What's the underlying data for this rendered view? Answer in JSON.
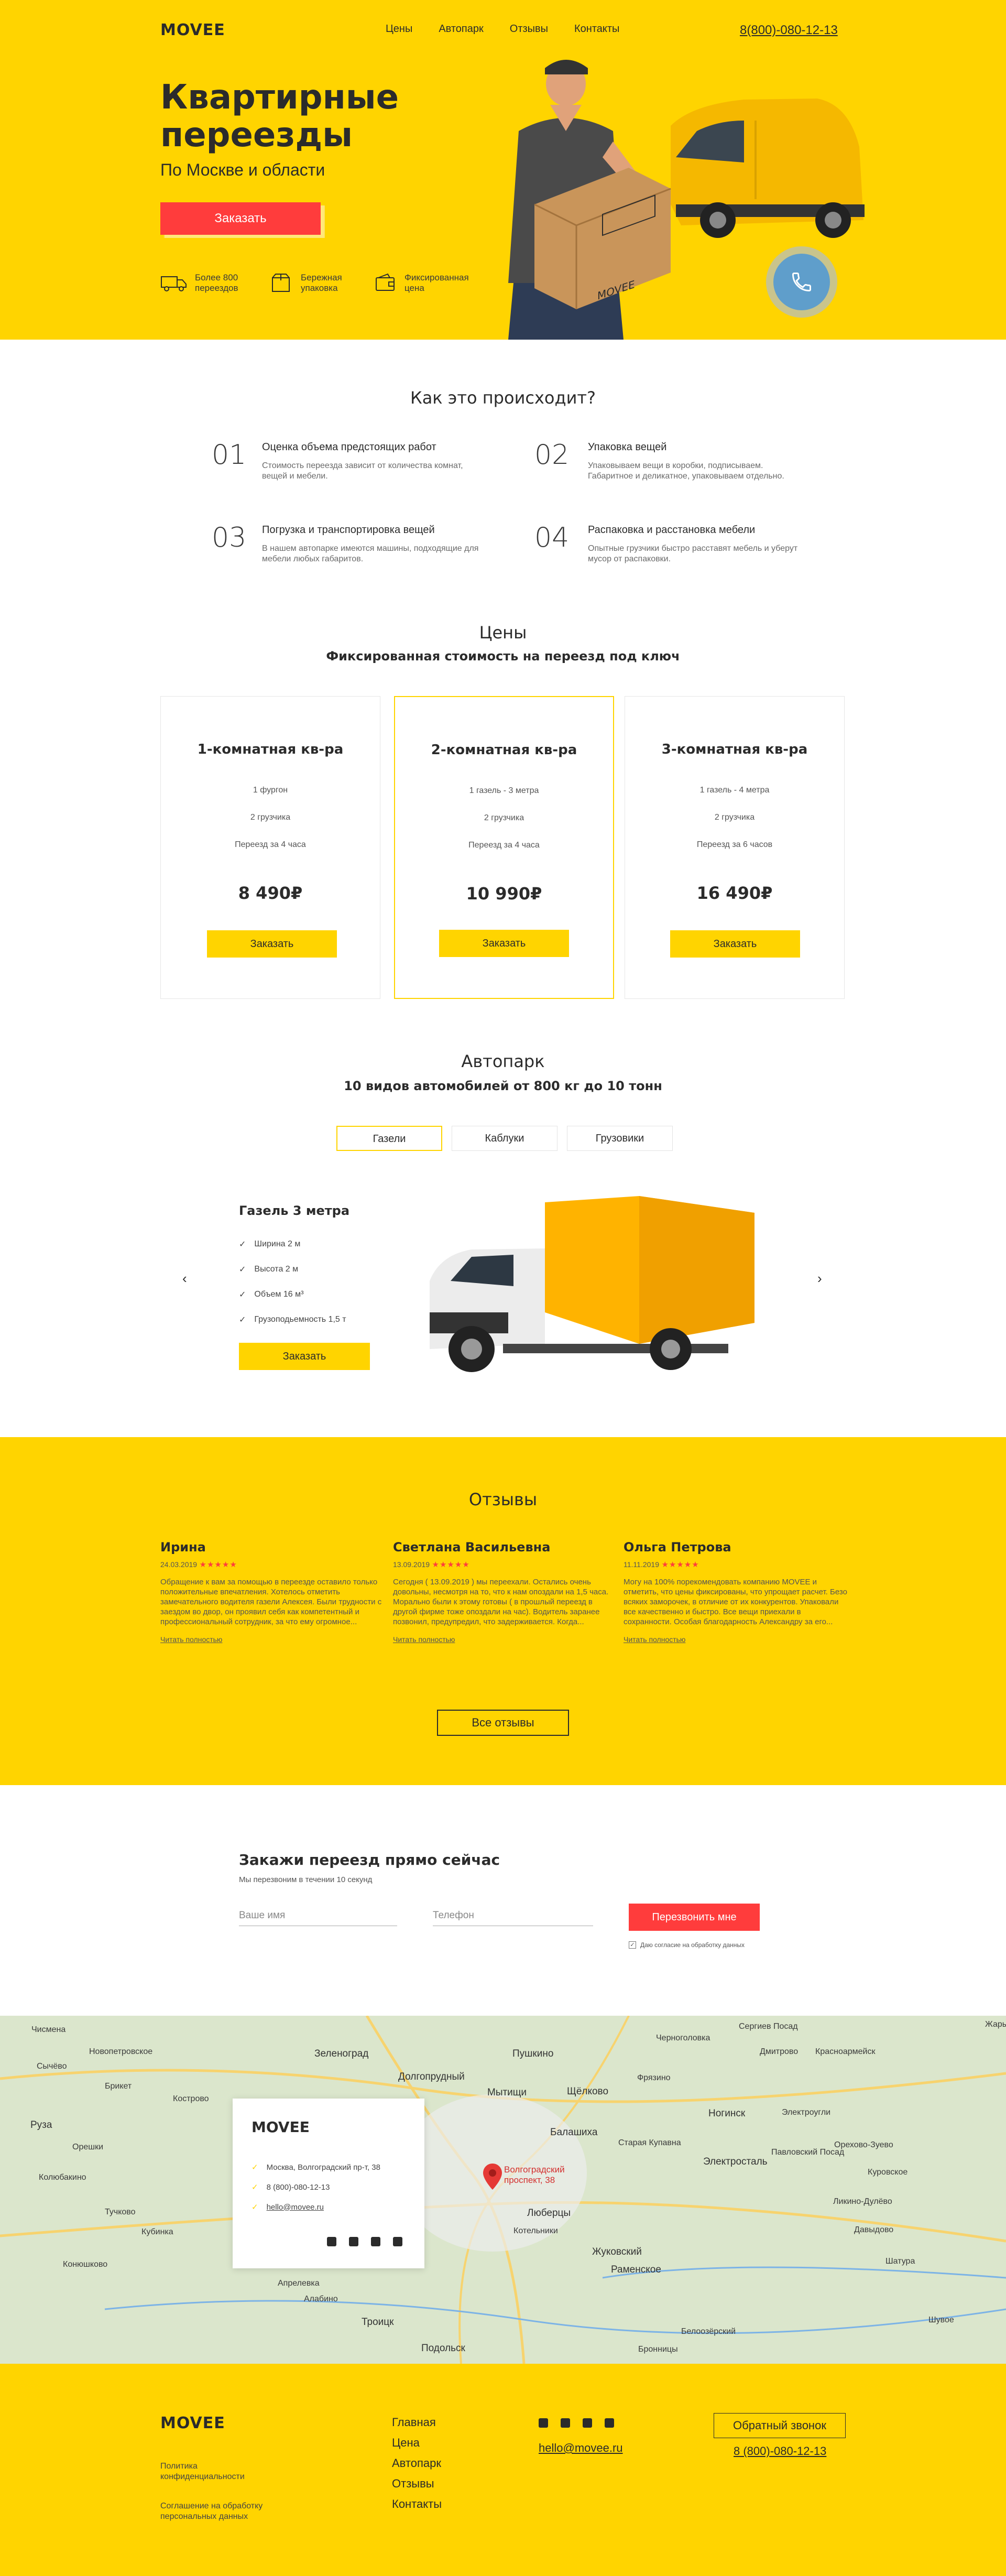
{
  "brand": {
    "logo": "MOVEE",
    "accent": "#ffd400",
    "cta": "#ff3c3c"
  },
  "header": {
    "nav": [
      "Цены",
      "Автопарк",
      "Отзывы",
      "Контакты"
    ],
    "phone": "8(800)-080-12-13"
  },
  "hero": {
    "title": "Квартирные переезды",
    "subtitle": "По Москве и области",
    "cta": "Заказать",
    "box_label": "MOVEE",
    "features": [
      {
        "icon": "truck-icon",
        "text": "Более 800 переездов"
      },
      {
        "icon": "box-icon",
        "text": "Бережная упаковка"
      },
      {
        "icon": "wallet-icon",
        "text": "Фиксированная цена"
      }
    ]
  },
  "how": {
    "title": "Как это происходит?",
    "steps": [
      {
        "num": "01",
        "title": "Оценка объема предстоящих работ",
        "text": "Стоимость переезда зависит от количества комнат, вещей и мебели."
      },
      {
        "num": "02",
        "title": "Упаковка вещей",
        "text": "Упаковываем вещи в коробки, подписываем. Габаритное и деликатное, упаковываем отдельно."
      },
      {
        "num": "03",
        "title": "Погрузка и транспортировка вещей",
        "text": "В нашем автопарке имеются машины, подходящие для мебели любых габаритов."
      },
      {
        "num": "04",
        "title": "Распаковка и расстановка мебели",
        "text": "Опытные грузчики быстро расставят мебель и уберут мусор от распаковки."
      }
    ]
  },
  "prices": {
    "title": "Цены",
    "subtitle": "Фиксированная стоимость на переезд под ключ",
    "cards": [
      {
        "title": "1-комнатная кв-ра",
        "lines": [
          "1 фургон",
          "2 грузчика",
          "Переезд за 4 часа"
        ],
        "price": "8 490₽",
        "button": "Заказать"
      },
      {
        "title": "2-комнатная кв-ра",
        "lines": [
          "1 газель - 3 метра",
          "2 грузчика",
          "Переезд за 4 часа"
        ],
        "price": "10 990₽",
        "button": "Заказать"
      },
      {
        "title": "3-комнатная кв-ра",
        "lines": [
          "1 газель - 4 метра",
          "2 грузчика",
          "Переезд за 6 часов"
        ],
        "price": "16 490₽",
        "button": "Заказать"
      }
    ]
  },
  "fleet": {
    "title": "Автопарк",
    "subtitle": "10 видов автомобилей от 800 кг до 10 тонн",
    "tabs": [
      "Газели",
      "Каблуки",
      "Грузовики"
    ],
    "active_tab": "Газели",
    "vehicle": {
      "name": "Газель 3 метра",
      "specs": [
        "Ширина 2 м",
        "Высота 2 м",
        "Объем 16 м³",
        "Грузоподьемность 1,5 т"
      ],
      "button": "Заказать"
    }
  },
  "reviews": {
    "title": "Отзывы",
    "items": [
      {
        "name": "Ирина",
        "date": "24.03.2019",
        "stars": "★★★★★",
        "text": "Обращение к вам за помощью в переезде оставило только положительные впечатления. Хотелось отметить замечательного водителя газели Алексея. Были трудности с заездом во двор, он проявил себя как компетентный и профессиональный сотрудник, за что ему огромное...",
        "link": "Читать полностью"
      },
      {
        "name": "Светлана Васильевна",
        "date": "13.09.2019",
        "stars": "★★★★★",
        "text": "Сегодня ( 13.09.2019 ) мы переехали. Остались очень довольны, несмотря на то, что к нам опоздали на 1,5 часа. Морально были к этому готовы ( в прошлый переезд в другой фирме тоже опоздали на час). Водитель заранее позвонил, предупредил, что задерживается. Когда...",
        "link": "Читать полностью"
      },
      {
        "name": "Ольга Петрова",
        "date": "11.11.2019",
        "stars": "★★★★★",
        "text": "Могу на 100% порекомендовать компанию MOVEE и отметить, что цены фиксированы, что упрощает расчет. Безо всяких заморочек, в отличие от их конкурентов. Упаковали все качественно и быстро. Все вещи приехали в сохранности. Особая благодарность Александру за его...",
        "link": "Читать полностью"
      }
    ],
    "all_button": "Все отзывы"
  },
  "order": {
    "title": "Закажи  переезд прямо сейчас",
    "subtitle": "Мы перезвоним в течении 10 секунд",
    "name_placeholder": "Ваше имя",
    "phone_placeholder": "Телефон",
    "button": "Перезвонить мне",
    "consent": "Даю согласие на обработку данных"
  },
  "map": {
    "card_logo": "MOVEE",
    "address": "Москва, Волгоградский пр-т, 38",
    "phone": "8 (800)-080-12-13",
    "email": "hello@movee.ru",
    "pin_label": "Волгоградский проспект, 38",
    "places": [
      "Чисмена",
      "Сычёво",
      "Новопетровское",
      "Брикет",
      "Кострово",
      "Руза",
      "Орешки",
      "Колюбакино",
      "Тучково",
      "Кубинка",
      "Конюшково",
      "Зеленоград",
      "Долгопрудный",
      "Мытищи",
      "Пушкино",
      "Щёлково",
      "Черноголовка",
      "Фрязино",
      "Ногинск",
      "Электроугли",
      "Балашиха",
      "Старая Купавна",
      "Электросталь",
      "Орехово-Зуево",
      "Павловский Посад",
      "Куровское",
      "Ликино-Дулёво",
      "Давыдово",
      "Люберцы",
      "Котельники",
      "Жуковский",
      "Раменское",
      "Апрелевка",
      "Алабино",
      "Троицк",
      "Подольск",
      "Бронницы",
      "Белоозёрский",
      "Шувое",
      "Сергиев Посад",
      "Жары",
      "Красноармейск",
      "Дмитрово",
      "Шатура"
    ]
  },
  "footer": {
    "logo": "MOVEE",
    "privacy": "Политика конфиденциальности",
    "agreement": "Соглашение на обработку персональных данных",
    "nav": [
      "Главная",
      "Цена",
      "Автопарк",
      "Отзывы",
      "Контакты"
    ],
    "email": "hello@movee.ru",
    "callback": "Обратный звонок",
    "phone": "8 (800)-080-12-13"
  }
}
